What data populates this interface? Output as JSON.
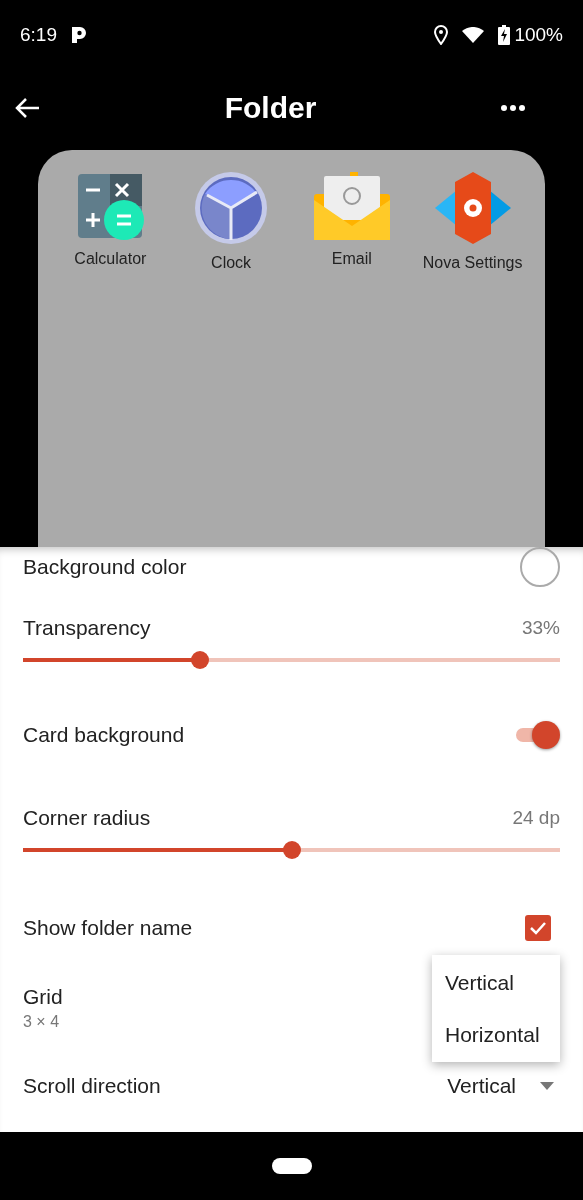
{
  "status_bar": {
    "time": "6:19",
    "battery": "100%"
  },
  "toolbar": {
    "title": "Folder"
  },
  "folder_preview": {
    "apps": [
      {
        "kind": "calculator",
        "label": "Calculator"
      },
      {
        "kind": "clock",
        "label": "Clock"
      },
      {
        "kind": "email",
        "label": "Email"
      },
      {
        "kind": "settings",
        "label": "Nova Settings"
      }
    ]
  },
  "settings": [
    {
      "kind": "color",
      "label": "Background color"
    },
    {
      "kind": "slider",
      "label": "Transparency",
      "reading": "33%",
      "level": 0.33
    },
    {
      "kind": "toggle",
      "label": "Card background",
      "on": true
    },
    {
      "kind": "slider",
      "label": "Corner radius",
      "reading": "24 dp",
      "level": 0.5
    },
    {
      "kind": "checkbox",
      "label": "Show folder name",
      "checked": true
    },
    {
      "kind": "text",
      "label": "Grid",
      "summary": "3 × 4"
    },
    {
      "kind": "dropdown",
      "label": "Scroll direction",
      "value": "Vertical"
    }
  ],
  "dropdown_menu": {
    "options": [
      {
        "label": "Vertical"
      },
      {
        "label": "Horizontal"
      }
    ]
  }
}
